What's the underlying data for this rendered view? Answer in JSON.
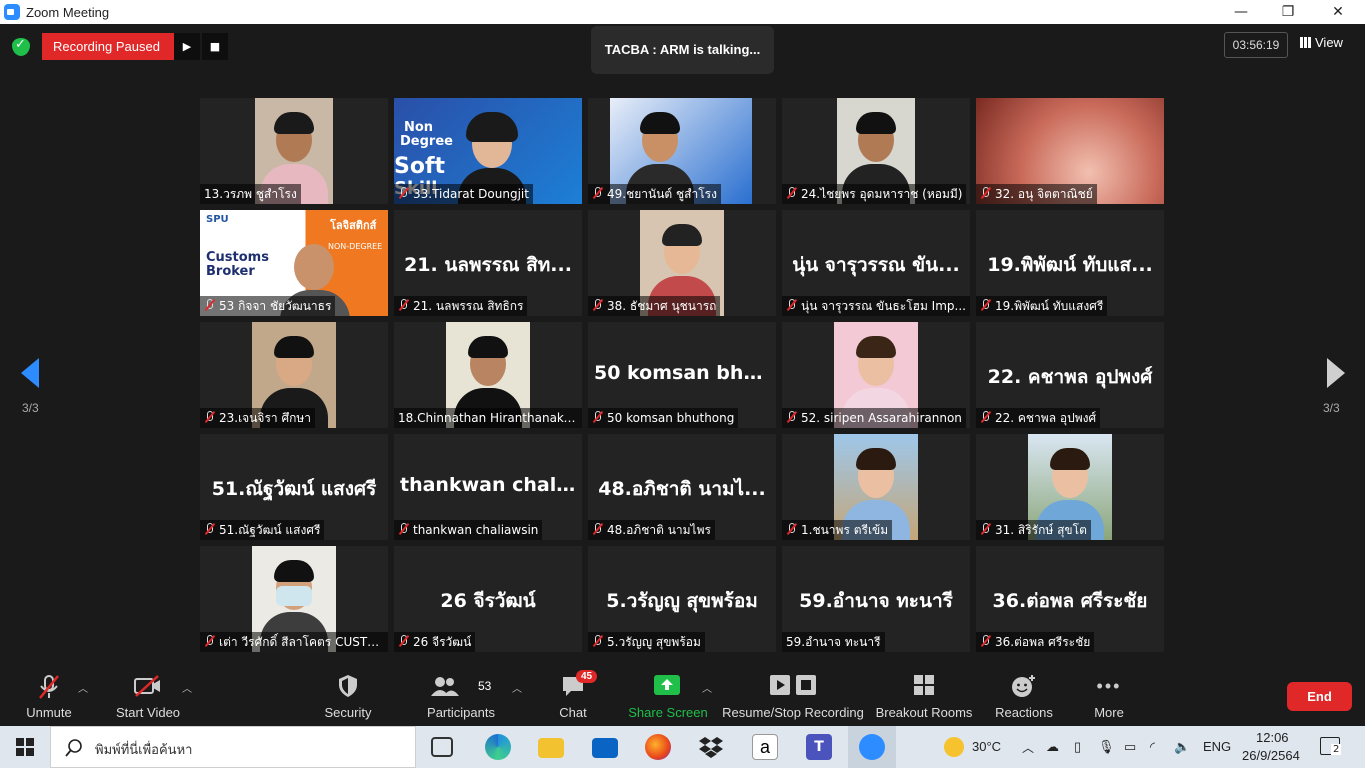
{
  "window": {
    "title": "Zoom Meeting",
    "controls": [
      "—",
      "❐",
      "✕"
    ]
  },
  "top": {
    "recording_label": "Recording Paused",
    "talking": "TACBA : ARM is talking...",
    "timer": "03:56:19",
    "view_label": "View"
  },
  "tiles": [
    {
      "caption": "13.วรภพ ชูสำโรง",
      "muted": false,
      "big": "",
      "video": "man1"
    },
    {
      "caption": "33.Tidarat Doungjit",
      "muted": true,
      "big": "",
      "video": "woman-banner"
    },
    {
      "caption": "49.ชยานันต์ ชูสำโรง",
      "muted": true,
      "big": "",
      "video": "boy-banner"
    },
    {
      "caption": "24.ไชยพร อุดมหาราช (หอมมี)",
      "muted": true,
      "big": "",
      "video": "man-car"
    },
    {
      "caption": "32. อนุ จิตตาณิชย์",
      "muted": true,
      "big": "",
      "video": "blur"
    },
    {
      "caption": "53 กิจจา ชัยวัฒนาธร",
      "muted": true,
      "big": "",
      "video": "poster"
    },
    {
      "caption": "21. นลพรรณ สิทธิกร",
      "muted": true,
      "big": "21. นลพรรณ สิท...",
      "video": ""
    },
    {
      "caption": "38. ธัชมาศ นุชนารถ",
      "muted": true,
      "big": "",
      "video": "woman2"
    },
    {
      "caption": "นุ่น จารุวรรณ ขันธะโฮม Imp...",
      "muted": true,
      "big": "นุ่น จารุวรรณ ขัน...",
      "video": ""
    },
    {
      "caption": "19.พิพัฒน์ ทับแสงศรี",
      "muted": true,
      "big": "19.พิพัฒน์ ทับแส...",
      "video": ""
    },
    {
      "caption": "23.เจนจิรา ศึกษา",
      "muted": true,
      "big": "",
      "video": "woman3"
    },
    {
      "caption": "18.Chinnathan Hiranthanaku...",
      "muted": false,
      "big": "",
      "video": "man-outdoor"
    },
    {
      "caption": "50 komsan bhuthong",
      "muted": true,
      "big": "50 komsan bhu...",
      "video": ""
    },
    {
      "caption": "52. siripen Assarahirannon",
      "muted": true,
      "big": "",
      "video": "woman-flowers"
    },
    {
      "caption": "22. คชาพล อุปพงศ์",
      "muted": true,
      "big": "22. คชาพล อุปพงศ์",
      "video": ""
    },
    {
      "caption": "51.ณัฐวัฒน์ แสงศรี",
      "muted": true,
      "big": "51.ณัฐวัฒน์ แสงศรี",
      "video": ""
    },
    {
      "caption": "thankwan chaliawsin",
      "muted": true,
      "big": "thankwan chali...",
      "video": ""
    },
    {
      "caption": "48.อภิชาติ นามไพร",
      "muted": true,
      "big": "48.อภิชาติ นามไ...",
      "video": ""
    },
    {
      "caption": "1.ชนาพร ตรีเข้ม",
      "muted": true,
      "big": "",
      "video": "woman-bridge"
    },
    {
      "caption": "31. สิริรักษ์ สุขโต",
      "muted": true,
      "big": "",
      "video": "woman-sky"
    },
    {
      "caption": "เต่า วีรศักดิ์ สีลาโคตร CUSTO...",
      "muted": true,
      "big": "",
      "video": "man-mask"
    },
    {
      "caption": "26 จีรวัฒน์",
      "muted": true,
      "big": "26 จีรวัฒน์",
      "video": ""
    },
    {
      "caption": "5.วรัญญู สุขพร้อม",
      "muted": true,
      "big": "5.วรัญญู สุขพร้อม",
      "video": ""
    },
    {
      "caption": "59.อำนาจ ทะนารี",
      "muted": false,
      "big": "59.อำนาจ ทะนารี",
      "video": ""
    },
    {
      "caption": "36.ต่อพล ศรีระชัย",
      "muted": true,
      "big": "36.ต่อพล ศรีระชัย",
      "video": ""
    }
  ],
  "poster_text": {
    "customs": "Customs",
    "broker": "Broker",
    "logo": "SPU",
    "headline": "โลจิสติกส์",
    "sub": "NON-DEGREE"
  },
  "banner_text": {
    "non": "Non",
    "degree": "Degree",
    "soft": "Soft",
    "skill": "Skill"
  },
  "pagination": {
    "left": "3/3",
    "right": "3/3"
  },
  "toolbar": {
    "unmute": "Unmute",
    "start_video": "Start Video",
    "security": "Security",
    "participants": "Participants",
    "participants_count": "53",
    "chat": "Chat",
    "chat_badge": "45",
    "share_screen": "Share Screen",
    "record": "Resume/Stop Recording",
    "breakout": "Breakout Rooms",
    "reactions": "Reactions",
    "more": "More",
    "end": "End"
  },
  "taskbar": {
    "search_placeholder": "พิมพ์ที่นี่เพื่อค้นหา",
    "weather": "30°C",
    "lang": "ENG",
    "time": "12:06",
    "date": "26/9/2564",
    "notif_count": "2"
  },
  "colors": {
    "accent": "#2d8cff",
    "record_red": "#e02828",
    "share_green": "#1fbf4a"
  }
}
